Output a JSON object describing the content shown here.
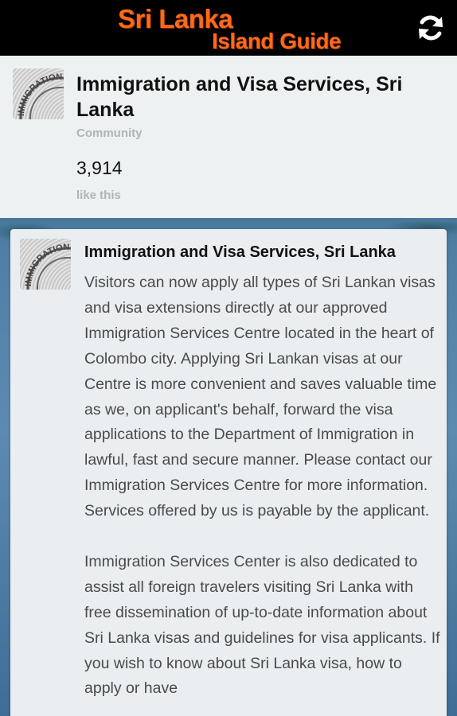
{
  "appbar": {
    "logo_line1": "Sri Lanka",
    "logo_line2": "Island Guide",
    "refresh_icon": "refresh-icon",
    "logo_color": "#ff6a1a",
    "background": "#000000"
  },
  "page": {
    "title": "Immigration and Visa Services, Sri Lanka",
    "category": "Community",
    "likes": "3,914",
    "likes_label": "like this",
    "avatar_text": "IMMIGRATION"
  },
  "post": {
    "author": "Immigration and Visa Services, Sri Lanka",
    "paragraphs": [
      "Visitors can now apply all types of Sri Lankan visas and visa extensions directly at our approved Immigration Services Centre located in the heart of Colombo city.  Applying Sri Lankan visas at our Centre is more convenient and saves valuable time as we, on applicant's behalf, forward the visa applications to the Department of Immigration in lawful, fast and secure manner. Please contact our Immigration Services Centre for more information. Services offered by us is payable by the applicant.",
      "Immigration Services Center is also dedicated to assist all foreign travelers visiting Sri Lanka with free dissemination of up-to-date information about Sri Lanka visas and guidelines for visa applicants. If you wish to know about Sri Lanka visa, how to apply or have"
    ]
  }
}
